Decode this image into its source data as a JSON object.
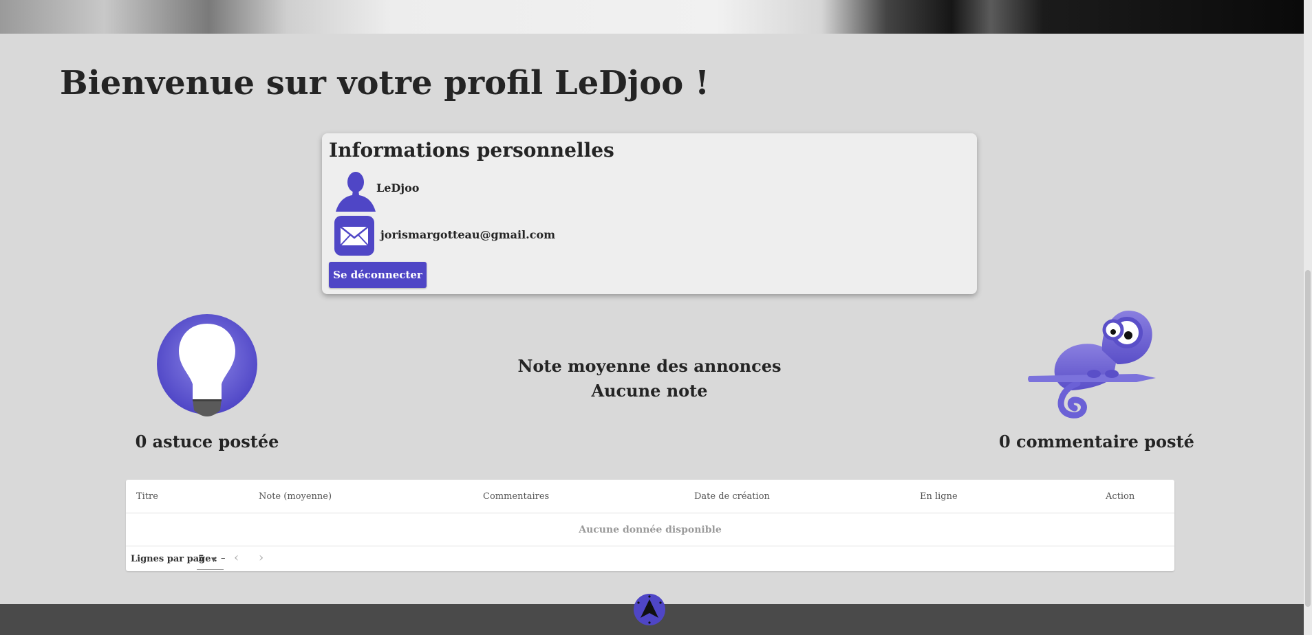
{
  "page": {
    "title": "Bienvenue sur votre profil LeDjoo !"
  },
  "profile": {
    "section_title": "Informations personnelles",
    "username": "LeDjoo",
    "email": "jorismargotteau@gmail.com",
    "logout_label": "Se déconnecter"
  },
  "stats": {
    "tips_count": "0 astuce postée",
    "rating_title": "Note moyenne des annonces",
    "rating_value": "Aucune note",
    "comments_count": "0 commentaire posté"
  },
  "table": {
    "columns": [
      "Titre",
      "Note (moyenne)",
      "Commentaires",
      "Date de création",
      "En ligne",
      "Action"
    ],
    "empty_message": "Aucune donnée disponible",
    "rows_per_page_label": "Lignes par page :",
    "rows_per_page_value": "5",
    "range_text": "–"
  },
  "icons": {
    "user": "user-icon",
    "mail": "mail-icon",
    "bulb": "lightbulb-icon",
    "chameleon": "chameleon-icon",
    "prev": "chevron-left-icon",
    "next": "chevron-right-icon",
    "back_to_top": "arrow-up-icon"
  },
  "colors": {
    "accent": "#4f46c6",
    "page_background": "#d9d9d9",
    "card_background": "#eeeeee",
    "footer": "#4a4a4a"
  }
}
